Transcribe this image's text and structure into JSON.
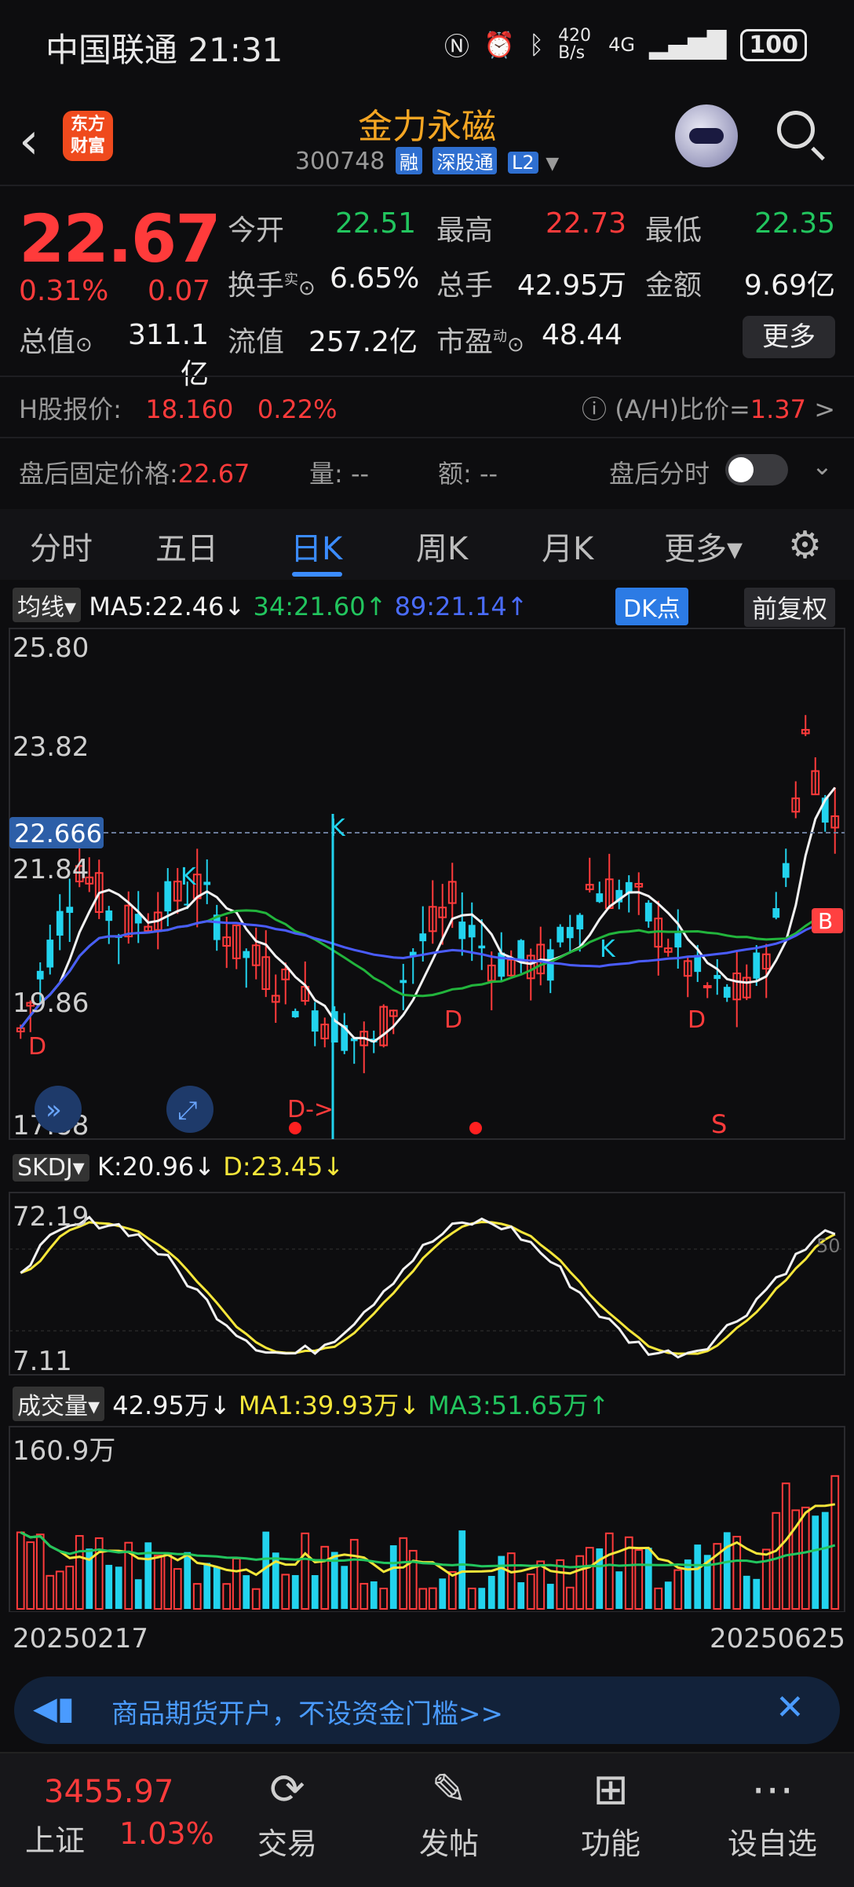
{
  "status_bar": {
    "carrier": "中国联通 21:31",
    "speed": "420 B/s",
    "network": "4G",
    "battery": "100"
  },
  "header": {
    "back_glyph": "‹",
    "logo_text": "东方财富",
    "stock_name": "金力永磁",
    "code": "300748",
    "tags": [
      "融",
      "深股通",
      "L2"
    ]
  },
  "quote": {
    "price": "22.67",
    "change_pct": "0.31%",
    "change": "0.07",
    "fields": [
      {
        "label": "今开",
        "value": "22.51",
        "color": "green"
      },
      {
        "label": "最高",
        "value": "22.73",
        "color": "red"
      },
      {
        "label": "最低",
        "value": "22.35",
        "color": "green"
      },
      {
        "label": "换手",
        "value": "6.65%",
        "color": "white"
      },
      {
        "label": "总手",
        "value": "42.95万",
        "color": "white"
      },
      {
        "label": "金额",
        "value": "9.69亿",
        "color": "white"
      },
      {
        "label": "总值",
        "value": "311.1亿",
        "color": "white"
      },
      {
        "label": "流值",
        "value": "257.2亿",
        "color": "white"
      },
      {
        "label": "市盈",
        "value": "48.44",
        "color": "white"
      }
    ],
    "sup_shi": "实",
    "sup_dong": "动",
    "more_label": "更多"
  },
  "hshare": {
    "label": "H股报价:",
    "price": "18.160",
    "pct": "0.22%",
    "ah_label": "(A/H)比价=",
    "ah_value": "1.37"
  },
  "after_hours": {
    "label": "盘后固定价格:",
    "price": "22.67",
    "vol_label": "量: --",
    "amt_label": "额: --",
    "intraday_label": "盘后分时"
  },
  "tabs": [
    "分时",
    "五日",
    "日K",
    "周K",
    "月K",
    "更多▾"
  ],
  "active_tab": "日K",
  "kline_panel": {
    "selector": "均线",
    "ma5": "MA5:22.46↓",
    "ma34": "34:21.60↑",
    "ma89": "89:21.14↑",
    "dk_btn": "DK点",
    "fq_btn": "前复权",
    "y_ticks": [
      "25.80",
      "23.82",
      "21.84",
      "19.86",
      "17.88"
    ],
    "cursor_price": "22.666",
    "markers": {
      "D_arrow": "D->",
      "S": "S",
      "B": "B",
      "K": "K",
      "D": "D"
    }
  },
  "skdj_panel": {
    "selector": "SKDJ",
    "k": "K:20.96↓",
    "d": "D:23.45↓",
    "y_top": "72.19",
    "y_bottom": "7.11",
    "level": "50"
  },
  "volume_panel": {
    "selector": "成交量",
    "vol": "42.95万↓",
    "ma1": "MA1:39.93万↓",
    "ma3": "MA3:51.65万↑",
    "y_top": "160.9万",
    "date_start": "20250217",
    "date_end": "20250625"
  },
  "banner": {
    "text": "商品期货开户，不设资金门槛>>"
  },
  "bottom_bar": {
    "index_value": "3455.97",
    "index_name": "上证",
    "index_pct": "1.03%",
    "items": [
      "交易",
      "发帖",
      "功能",
      "设自选"
    ]
  },
  "colors": {
    "up": "#ff3b3b",
    "down": "#22d3ee",
    "accent": "#3b8cff",
    "brand": "#f5a623"
  }
}
